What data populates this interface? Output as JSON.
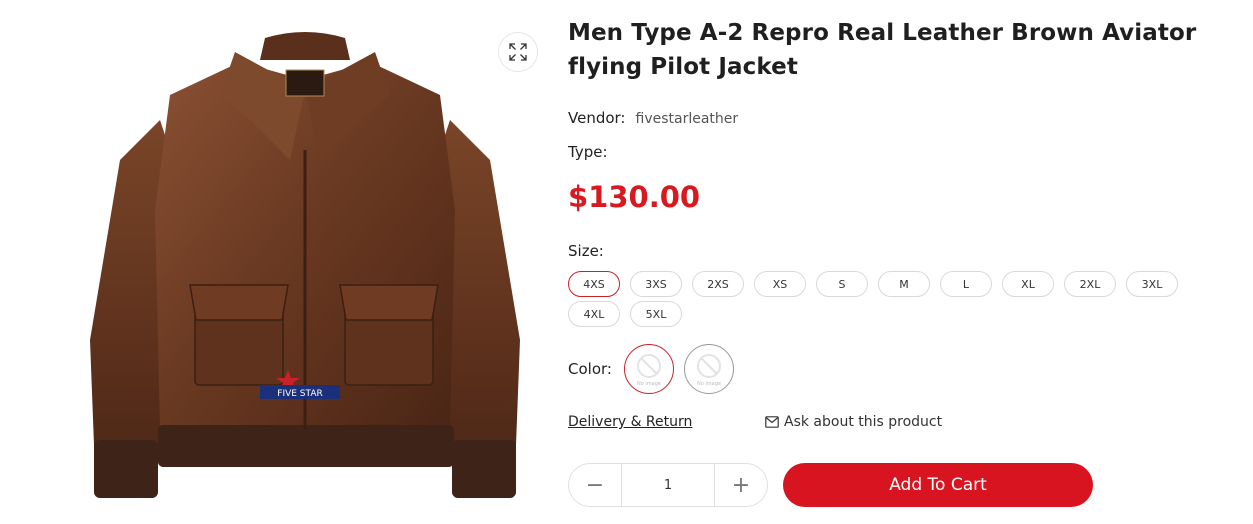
{
  "product": {
    "title": "Men Type A-2 Repro Real Leather Brown Aviator flying Pilot Jacket",
    "vendor_label": "Vendor:",
    "vendor_value": "fivestarleather",
    "type_label": "Type:",
    "price": "$130.00",
    "image_logo_text": "FIVE STAR"
  },
  "options": {
    "size_label": "Size:",
    "sizes": [
      "4XS",
      "3XS",
      "2XS",
      "XS",
      "S",
      "M",
      "L",
      "XL",
      "2XL",
      "3XL",
      "4XL",
      "5XL"
    ],
    "selected_size": "4XS",
    "color_label": "Color:",
    "color_swatch_text": "No image"
  },
  "links": {
    "delivery": "Delivery & Return",
    "ask": "Ask about this product"
  },
  "cart": {
    "minus": "−",
    "plus": "+",
    "quantity": "1",
    "add_to_cart": "Add To Cart"
  },
  "colors": {
    "accent_red": "#d7141f",
    "price_red": "#d71920",
    "leather_brown": "#6b3a22"
  }
}
